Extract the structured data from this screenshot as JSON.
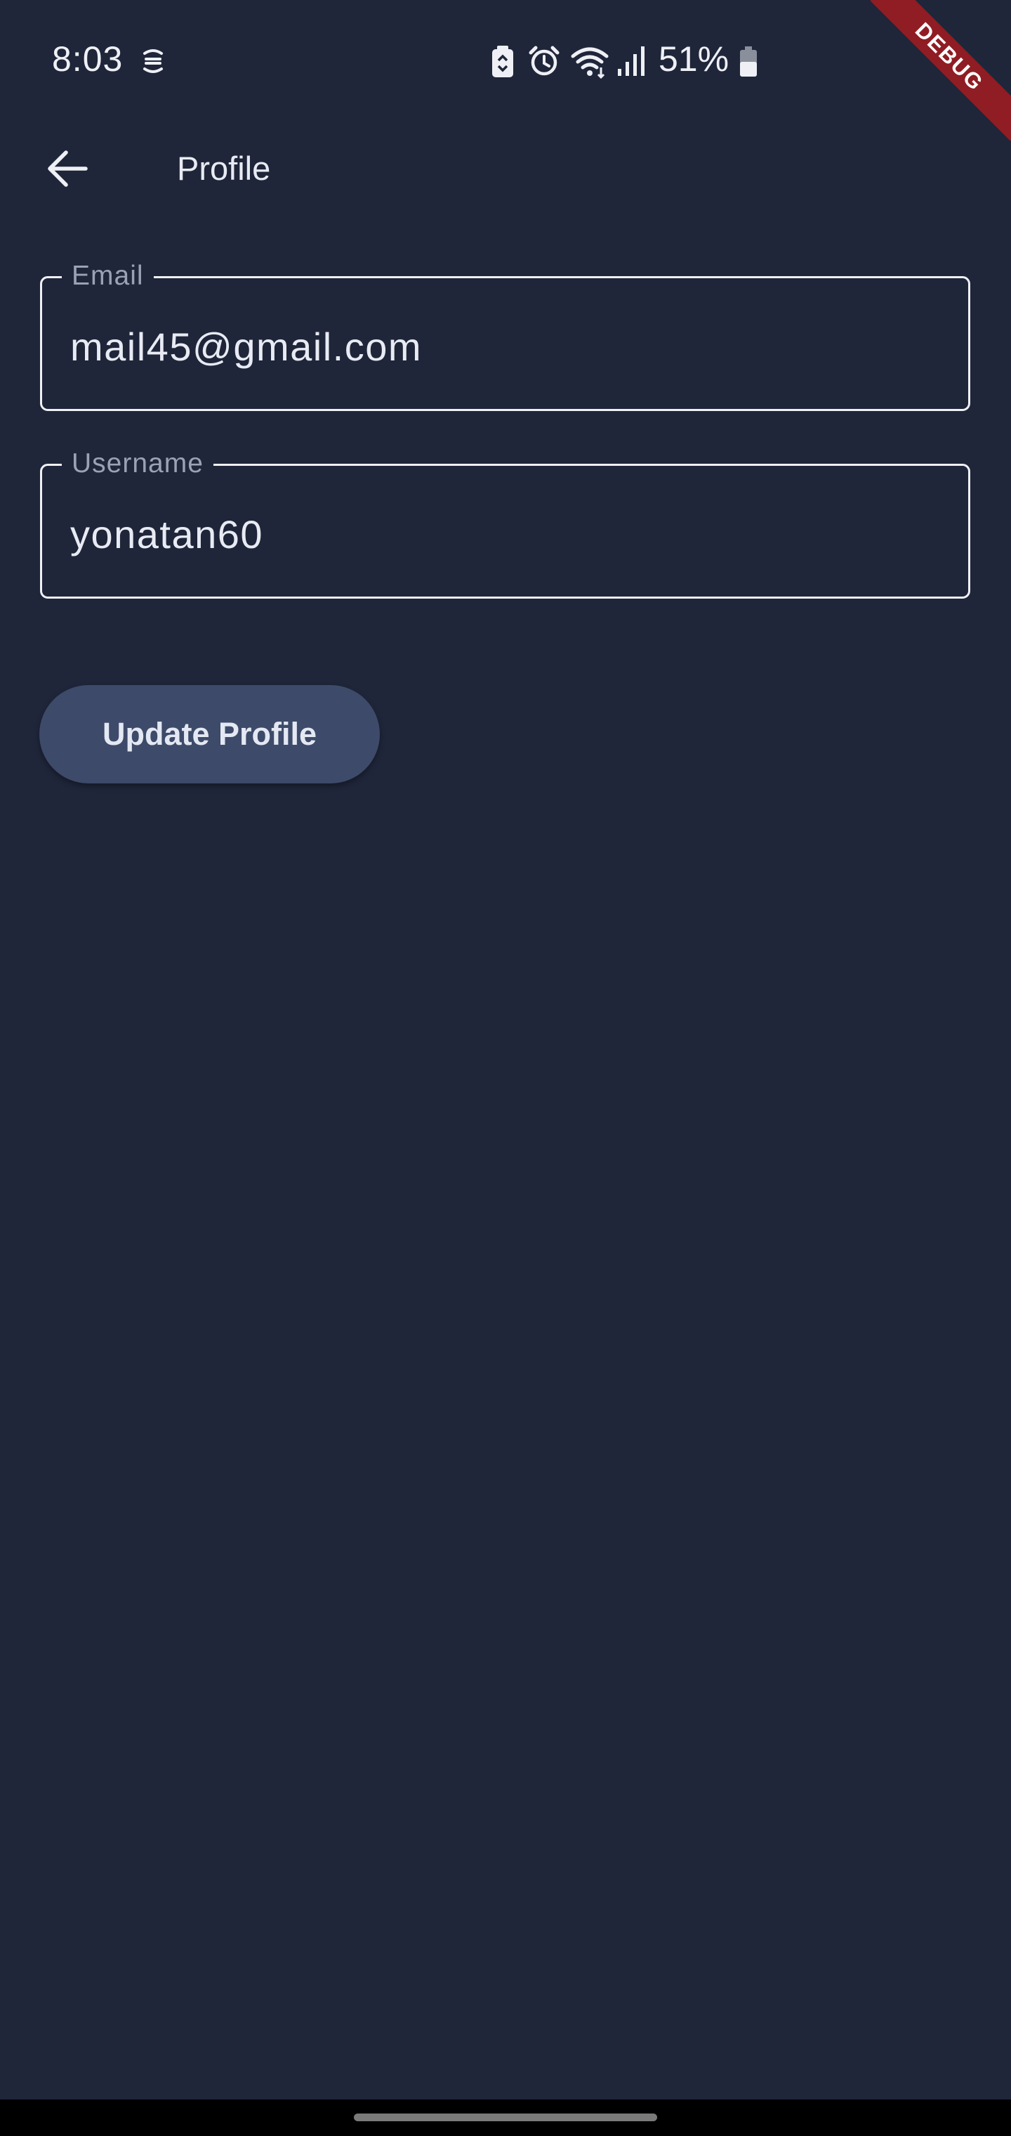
{
  "status_bar": {
    "time": "8:03",
    "battery_percent": "51%",
    "icons": [
      "sync-icon",
      "battery-saver-icon",
      "alarm-icon",
      "wifi-icon",
      "signal-icon",
      "battery-icon"
    ]
  },
  "debug_banner": {
    "label": "DEBUG",
    "color": "#8f1d23"
  },
  "app_bar": {
    "title": "Profile",
    "back_icon": "arrow-back-icon"
  },
  "form": {
    "email": {
      "label": "Email",
      "value": "mail45@gmail.com"
    },
    "username": {
      "label": "Username",
      "value": "yonatan60"
    }
  },
  "actions": {
    "update_label": "Update Profile"
  },
  "theme": {
    "background": "#1f263a",
    "button": "#3e4a69",
    "text": "#e8ebf3"
  }
}
